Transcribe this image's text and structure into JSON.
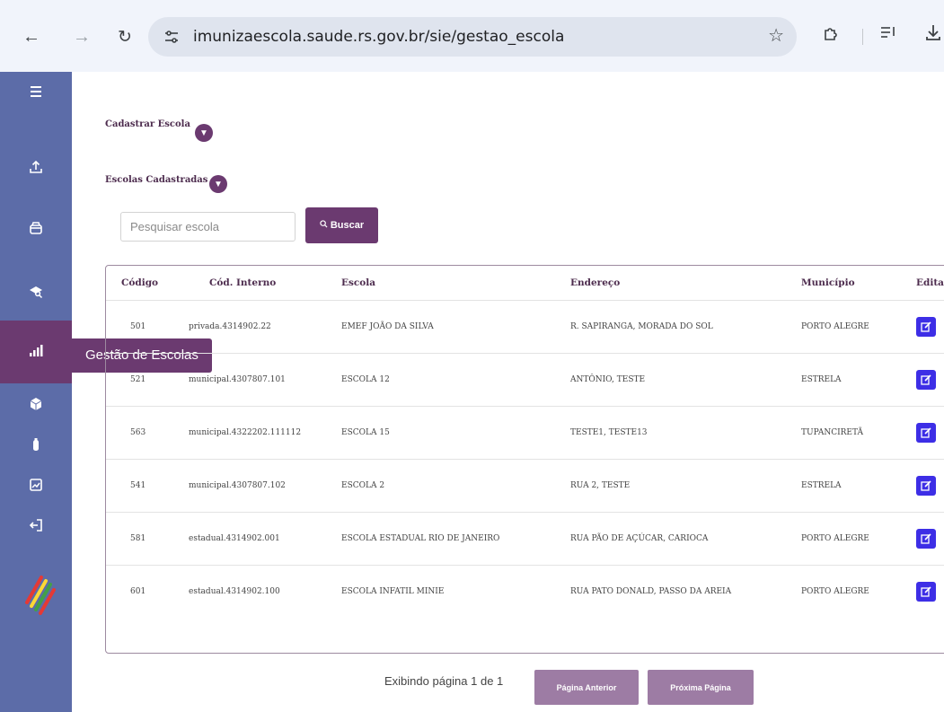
{
  "browser": {
    "url": "imunizaescola.saude.rs.gov.br/sie/gestao_escola",
    "icons": {
      "back": "arrow-left-icon",
      "forward": "arrow-right-icon",
      "reload": "reload-icon",
      "site_info": "tune-icon",
      "bookmark": "star-icon",
      "extensions": "puzzle-icon",
      "reading_list": "reading-list-icon",
      "downloads": "download-icon"
    }
  },
  "sidebar": {
    "items": [
      {
        "icon": "menu-icon"
      },
      {
        "icon": "upload-icon"
      },
      {
        "icon": "archive-icon"
      },
      {
        "icon": "search-school-icon"
      },
      {
        "icon": "chart-icon",
        "active": true
      },
      {
        "icon": "cube-icon"
      },
      {
        "icon": "vaccine-icon"
      },
      {
        "icon": "report-icon"
      },
      {
        "icon": "logout-icon"
      }
    ],
    "tooltip": "Gestão de Escolas",
    "colors": {
      "background": "#5c6ca8",
      "active": "#6b3a70"
    }
  },
  "main": {
    "register_section": "Cadastrar Escola",
    "registered_section": "Escolas Cadastradas",
    "search": {
      "placeholder": "Pesquisar escola",
      "button_label": "Buscar"
    },
    "table": {
      "columns": [
        "Código",
        "Cód. Interno",
        "Escola",
        "Endereço",
        "Município",
        "Editar"
      ],
      "rows": [
        {
          "codigo": "501",
          "interno": "privada.4314902.22",
          "escola": "EMEF JOÃO DA SILVA",
          "endereco": "R. SAPIRANGA, MORADA DO SOL",
          "municipio": "PORTO ALEGRE"
        },
        {
          "codigo": "521",
          "interno": "municipal.4307807.101",
          "escola": "ESCOLA 12",
          "endereco": "ANTÔNIO, TESTE",
          "municipio": "ESTRELA"
        },
        {
          "codigo": "563",
          "interno": "municipal.4322202.111112",
          "escola": "ESCOLA 15",
          "endereco": "TESTE1, TESTE13",
          "municipio": "TUPANCIRETÃ"
        },
        {
          "codigo": "541",
          "interno": "municipal.4307807.102",
          "escola": "ESCOLA 2",
          "endereco": "RUA 2, TESTE",
          "municipio": "ESTRELA"
        },
        {
          "codigo": "581",
          "interno": "estadual.4314902.001",
          "escola": "ESCOLA ESTADUAL RIO DE JANEIRO",
          "endereco": "RUA PÃO DE AÇÚCAR, CARIOCA",
          "municipio": "PORTO ALEGRE"
        },
        {
          "codigo": "601",
          "interno": "estadual.4314902.100",
          "escola": "ESCOLA INFATIL MINIE",
          "endereco": "RUA PATO DONALD, PASSO DA AREIA",
          "municipio": "PORTO ALEGRE"
        }
      ],
      "edit_icon": "edit-icon"
    },
    "pagination": {
      "text": "Exibindo página 1 de 1",
      "prev_label": "Página Anterior",
      "next_label": "Próxima Página"
    },
    "colors": {
      "accent": "#6b3a70",
      "edit_button": "#3d2ee6",
      "pagination_button": "#9d7ca4"
    }
  }
}
